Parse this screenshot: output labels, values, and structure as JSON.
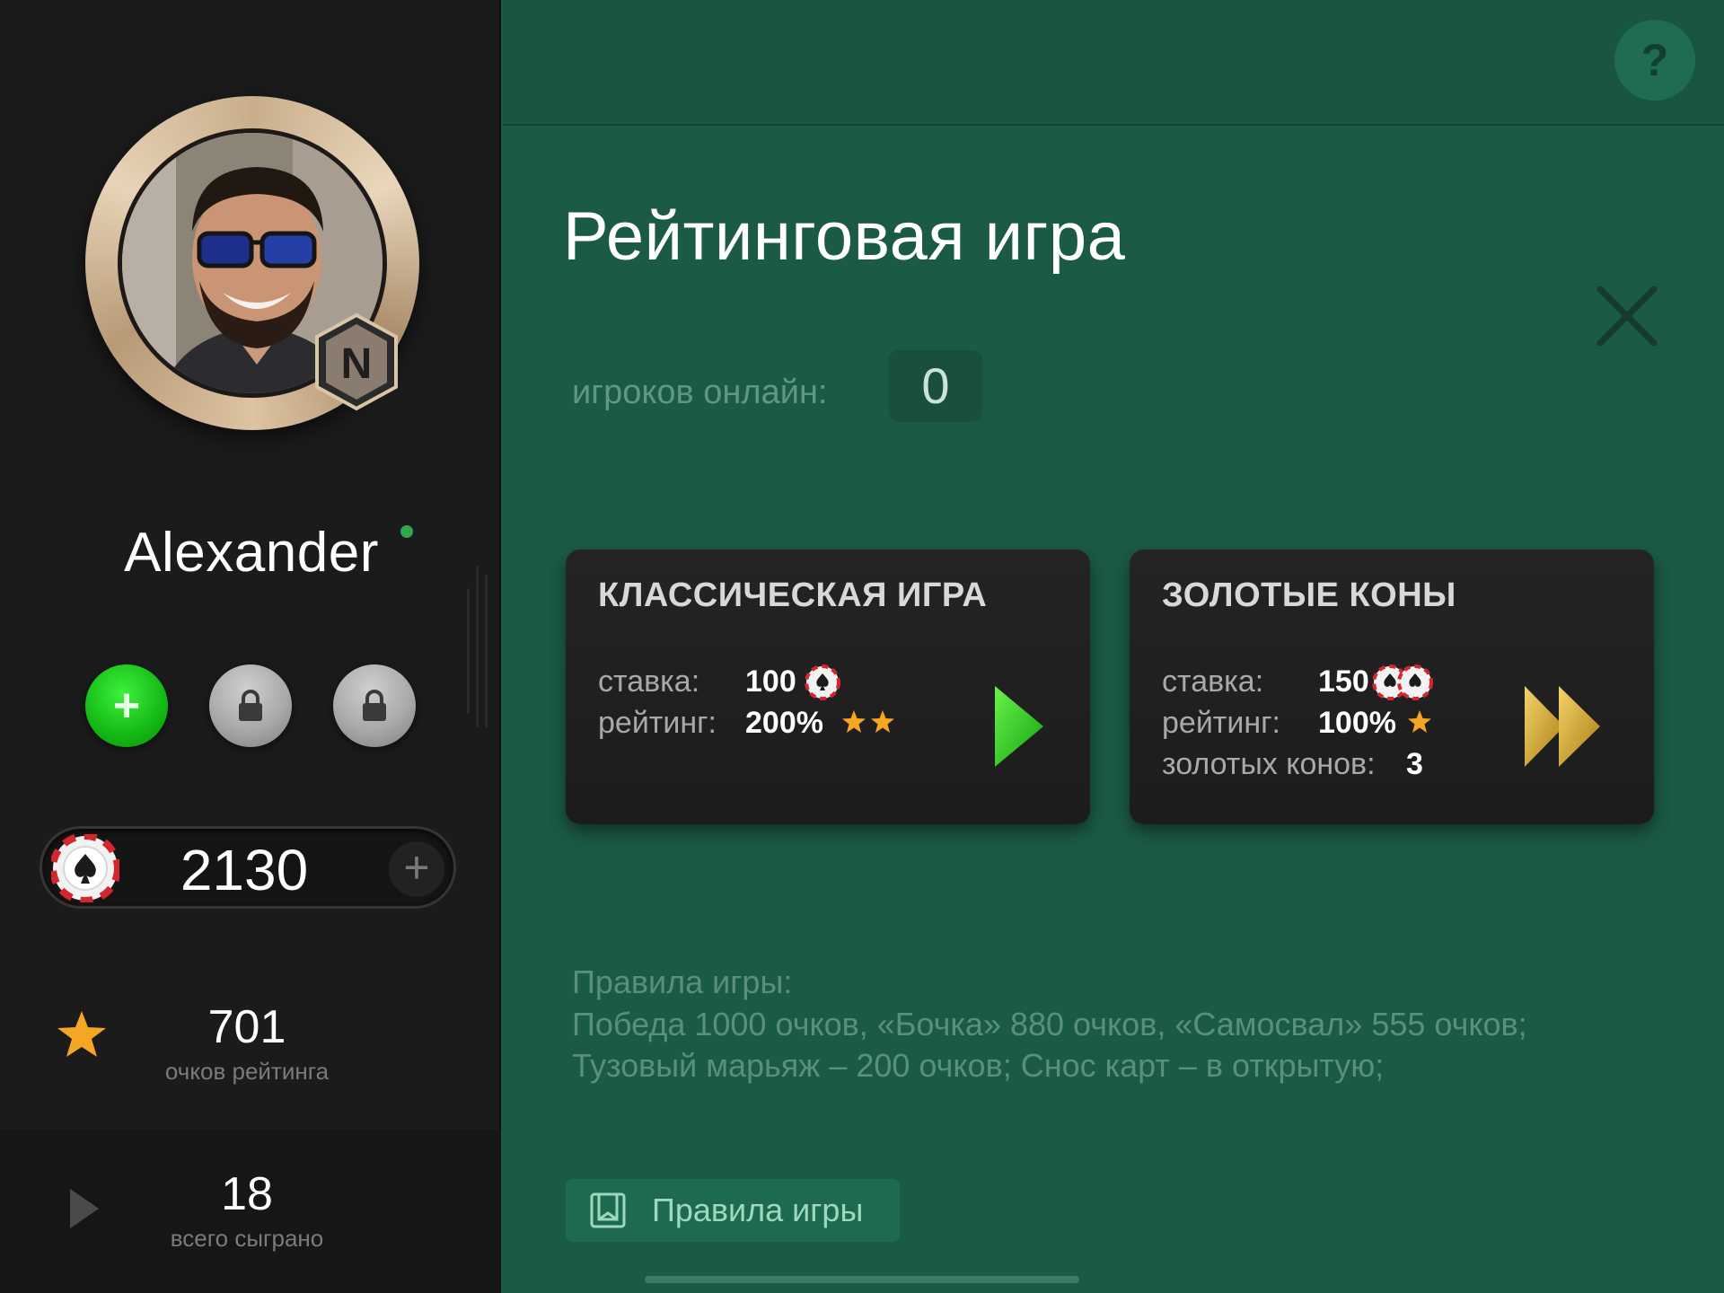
{
  "profile": {
    "name": "Alexander",
    "badge_letter": "N",
    "status_color": "#2ea84b"
  },
  "slots": [
    {
      "state": "add",
      "icon": "plus-icon"
    },
    {
      "state": "locked",
      "icon": "lock-icon"
    },
    {
      "state": "locked",
      "icon": "lock-icon"
    }
  ],
  "balance": {
    "value": "2130",
    "icon": "poker-chip-icon",
    "add_icon": "plus-icon"
  },
  "stats": {
    "rating": {
      "value": "701",
      "label": "очков рейтинга",
      "icon": "star-icon"
    },
    "played": {
      "value": "18",
      "label": "всего сыграно",
      "icon": "play-icon"
    }
  },
  "header": {
    "help_label": "?"
  },
  "main": {
    "title": "Рейтинговая игра",
    "online_label": "игроков онлайн:",
    "online_count": "0"
  },
  "modes": [
    {
      "title": "КЛАССИЧЕСКАЯ ИГРА",
      "stake_label": "ставка:",
      "stake_value": "100",
      "rating_label": "рейтинг:",
      "rating_value": "200%",
      "stars": 2,
      "action_icon": "play-icon",
      "action_color": "#2fcf1d"
    },
    {
      "title": "ЗОЛОТЫЕ КОНЫ",
      "stake_label": "ставка:",
      "stake_value": "150",
      "rating_label": "рейтинг:",
      "rating_value": "100%",
      "stars": 1,
      "gold_label": "золотых конов:",
      "gold_value": "3",
      "action_icon": "fast-forward-icon",
      "action_color": "#c9a227"
    }
  ],
  "rules": {
    "heading": "Правила игры:",
    "lines": [
      "Победа 1000 очков, «Бочка» 880 очков, «Самосвал» 555 очков;",
      "Тузовый марьяж – 200 очков; Снос карт – в открытую;"
    ],
    "button_label": "Правила игры",
    "button_icon": "book-icon"
  },
  "colors": {
    "main_bg": "#1b5a46",
    "sidebar_bg": "#1b1b1c",
    "card_bg": "#222222",
    "star": "#f5a623",
    "chip_red": "#d3262e"
  }
}
